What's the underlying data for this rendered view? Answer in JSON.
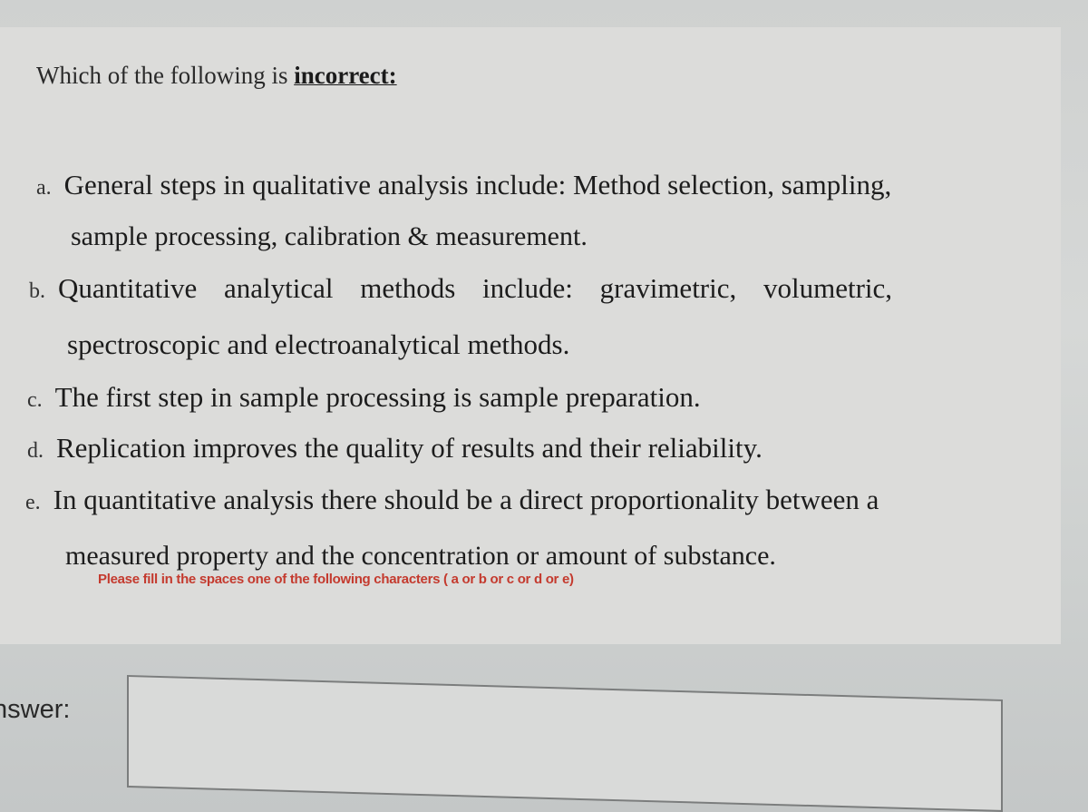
{
  "question": {
    "prefix": "Which of the following is ",
    "emphasis": "incorrect:"
  },
  "options": [
    {
      "letter": "a.",
      "line1": "General steps in qualitative analysis include: Method selection, sampling,",
      "line2": "sample processing, calibration & measurement."
    },
    {
      "letter": "b.",
      "line1": "Quantitative analytical methods include: gravimetric, volumetric,",
      "line2": "spectroscopic and electroanalytical methods."
    },
    {
      "letter": "c.",
      "line1": "The first step in sample processing is sample preparation."
    },
    {
      "letter": "d.",
      "line1": "Replication improves the quality of results and their reliability."
    },
    {
      "letter": "e.",
      "line1": "In quantitative analysis there should be a direct proportionality between a",
      "line2": "measured property and the concentration or amount of substance."
    }
  ],
  "instruction": "Please fill in the spaces one of the following characters ( a or b or c or d or e)",
  "answer": {
    "label": "nswer:",
    "value": "",
    "placeholder": ""
  },
  "colors": {
    "instruction": "#c43a2e"
  }
}
